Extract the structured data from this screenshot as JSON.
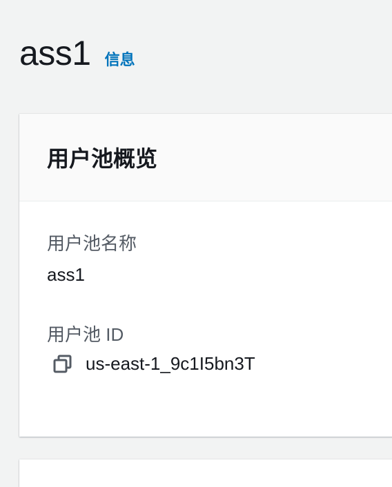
{
  "header": {
    "title": "ass1",
    "info_link": "信息"
  },
  "overview_panel": {
    "title": "用户池概览",
    "fields": [
      {
        "label": "用户池名称",
        "value": "ass1"
      },
      {
        "label": "用户池 ID",
        "value": "us-east-1_9c1I5bn3T",
        "icon": "copy-icon"
      }
    ]
  },
  "colors": {
    "background": "#f2f3f3",
    "panel": "#ffffff",
    "link": "#0073bb",
    "text": "#16191f",
    "label": "#545b64"
  }
}
